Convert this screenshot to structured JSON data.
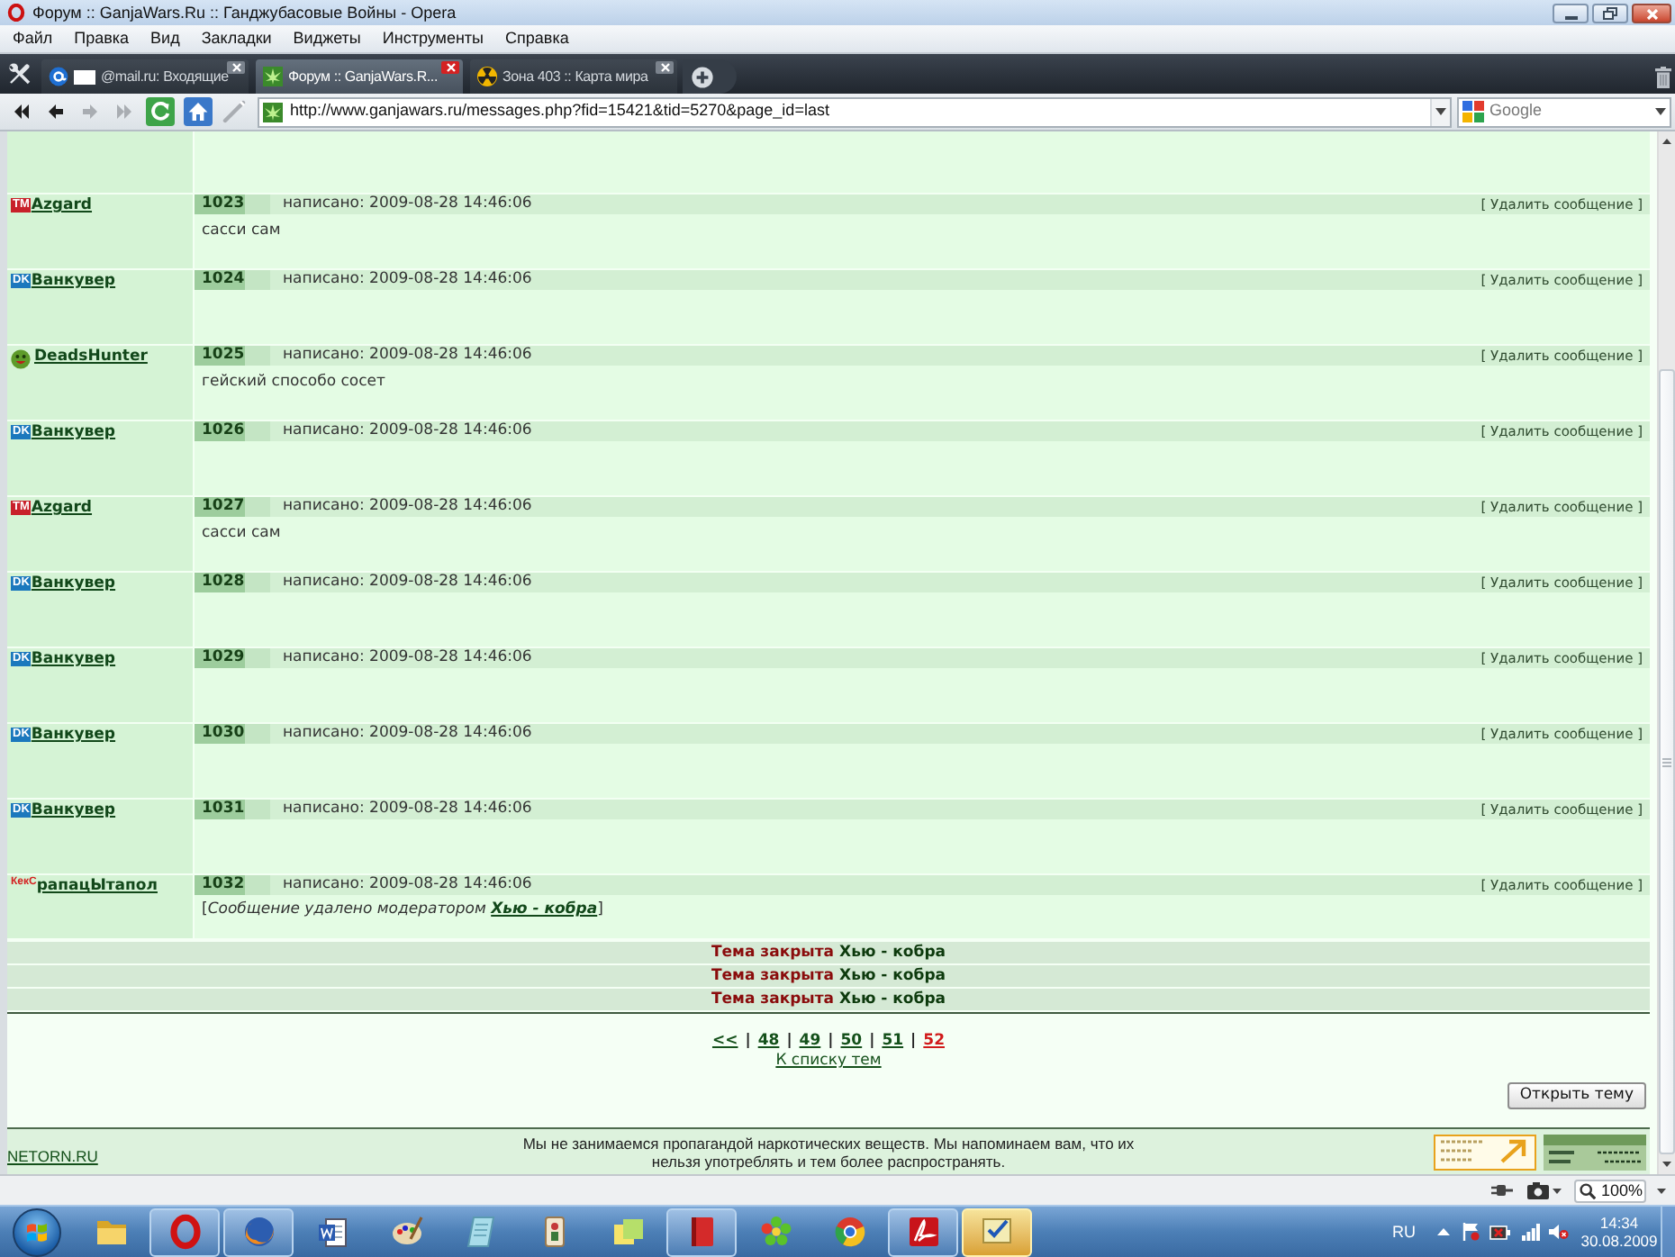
{
  "window": {
    "title": "Форум :: GanjaWars.Ru :: Ганджубасовые Войны - Opera"
  },
  "menu": [
    "Файл",
    "Правка",
    "Вид",
    "Закладки",
    "Виджеты",
    "Инструменты",
    "Справка"
  ],
  "tabs": [
    {
      "title": "@mail.ru: Входящие",
      "kind": "mail",
      "redacted": true,
      "selected": false
    },
    {
      "title": "Форум :: GanjaWars.R...",
      "kind": "leaf",
      "redacted": false,
      "selected": true
    },
    {
      "title": "Зона 403 :: Карта мира",
      "kind": "radiation",
      "redacted": false,
      "selected": false
    }
  ],
  "toolbar": {
    "buttons": [
      {
        "kind": "rewind",
        "disabled": false
      },
      {
        "kind": "back",
        "disabled": false
      },
      {
        "kind": "forward",
        "disabled": true
      },
      {
        "kind": "fast_forward",
        "disabled": true
      },
      {
        "kind": "reload",
        "disabled": false
      },
      {
        "kind": "home",
        "disabled": false
      },
      {
        "kind": "wand",
        "disabled": true
      }
    ],
    "address": {
      "kind": "leaf",
      "url": "http://www.ganjawars.ru/messages.php?fid=15421&tid=5270&page_id=last"
    },
    "search": {
      "placeholder": "Google"
    }
  },
  "posts": [
    {
      "number": "1023",
      "author": "Azgard",
      "clan": {
        "kind": "tile",
        "label": "TM",
        "color": "#c8202a"
      },
      "posted": "написано: 2009-08-28 14:46:06",
      "delete": "[ Удалить сообщение ]",
      "message": "сасси сам"
    },
    {
      "number": "1024",
      "author": "Ванкувер",
      "clan": {
        "kind": "tile",
        "label": "DK",
        "color": "#1b78bd"
      },
      "posted": "написано: 2009-08-28 14:46:06",
      "delete": "[ Удалить сообщение ]"
    },
    {
      "number": "1025",
      "author": "DeadsHunter",
      "clan": {
        "kind": "smiley"
      },
      "posted": "написано: 2009-08-28 14:46:06",
      "delete": "[ Удалить сообщение ]",
      "message": "гейский способо сосет"
    },
    {
      "number": "1026",
      "author": "Ванкувер",
      "clan": {
        "kind": "tile",
        "label": "DK",
        "color": "#1b78bd"
      },
      "posted": "написано: 2009-08-28 14:46:06",
      "delete": "[ Удалить сообщение ]"
    },
    {
      "number": "1027",
      "author": "Azgard",
      "clan": {
        "kind": "tile",
        "label": "TM",
        "color": "#c8202a"
      },
      "posted": "написано: 2009-08-28 14:46:06",
      "delete": "[ Удалить сообщение ]",
      "message": "сасси сам"
    },
    {
      "number": "1028",
      "author": "Ванкувер",
      "clan": {
        "kind": "tile",
        "label": "DK",
        "color": "#1b78bd"
      },
      "posted": "написано: 2009-08-28 14:46:06",
      "delete": "[ Удалить сообщение ]"
    },
    {
      "number": "1029",
      "author": "Ванкувер",
      "clan": {
        "kind": "tile",
        "label": "DK",
        "color": "#1b78bd"
      },
      "posted": "написано: 2009-08-28 14:46:06",
      "delete": "[ Удалить сообщение ]"
    },
    {
      "number": "1030",
      "author": "Ванкувер",
      "clan": {
        "kind": "tile",
        "label": "DK",
        "color": "#1b78bd"
      },
      "posted": "написано: 2009-08-28 14:46:06",
      "delete": "[ Удалить сообщение ]"
    },
    {
      "number": "1031",
      "author": "Ванкувер",
      "clan": {
        "kind": "tile",
        "label": "DK",
        "color": "#1b78bd"
      },
      "posted": "написано: 2009-08-28 14:46:06",
      "delete": "[ Удалить сообщение ]"
    },
    {
      "number": "1032",
      "author": "рапацЫтапол",
      "clan": {
        "kind": "text",
        "label": "КекС",
        "color": "#d42020"
      },
      "posted": "написано: 2009-08-28 14:46:06",
      "delete": "[ Удалить сообщение ]",
      "moderation": {
        "before": "[*Сообщение удалено модератором* ",
        "moderator": "Хью - кобра",
        "after": "]"
      }
    }
  ],
  "closed_notices": [
    {
      "status": "Тема закрыта",
      "moderator": "Хью - кобра"
    },
    {
      "status": "Тема закрыта",
      "moderator": "Хью - кобра"
    },
    {
      "status": "Тема закрыта",
      "moderator": "Хью - кобра"
    }
  ],
  "pagination": {
    "items": [
      {
        "label": "<<",
        "selected": false
      },
      {
        "separator": "|",
        "label": "48",
        "selected": false
      },
      {
        "separator": "|",
        "label": "49",
        "selected": false
      },
      {
        "separator": "|",
        "label": "50",
        "selected": false
      },
      {
        "separator": "|",
        "label": "51",
        "selected": false
      },
      {
        "separator": "|",
        "label": "52",
        "selected": true
      }
    ],
    "topic_list_link": "К списку тем"
  },
  "open_topic_button": "Открыть тему",
  "footer": {
    "site_link": "NETORN.RU",
    "disclaimer": [
      "Мы не занимаемся пропагандой наркотических веществ. Мы напоминаем вам, что их",
      "нельзя употреблять и тем более распространять."
    ]
  },
  "status_bar": {
    "zoom": "100%"
  },
  "taskbar": {
    "apps": [
      {
        "kind": "folder",
        "open": false,
        "attention": false
      },
      {
        "kind": "ring",
        "open": true,
        "attention": false
      },
      {
        "kind": "globe",
        "open": true,
        "attention": false
      },
      {
        "kind": "document",
        "open": false,
        "attention": false
      },
      {
        "kind": "palette",
        "open": false,
        "attention": false
      },
      {
        "kind": "pad",
        "open": false,
        "attention": false
      },
      {
        "kind": "tile",
        "open": false,
        "attention": false
      },
      {
        "kind": "note",
        "open": false,
        "attention": false
      },
      {
        "kind": "book",
        "open": true,
        "attention": false
      },
      {
        "kind": "flower",
        "open": false,
        "attention": false
      },
      {
        "kind": "wheel",
        "open": false,
        "attention": false
      },
      {
        "kind": "pdf",
        "open": true,
        "attention": false
      },
      {
        "kind": "checklist",
        "open": true,
        "attention": true
      }
    ],
    "language": "RU",
    "time": "14:34",
    "date": "30.08.2009"
  }
}
